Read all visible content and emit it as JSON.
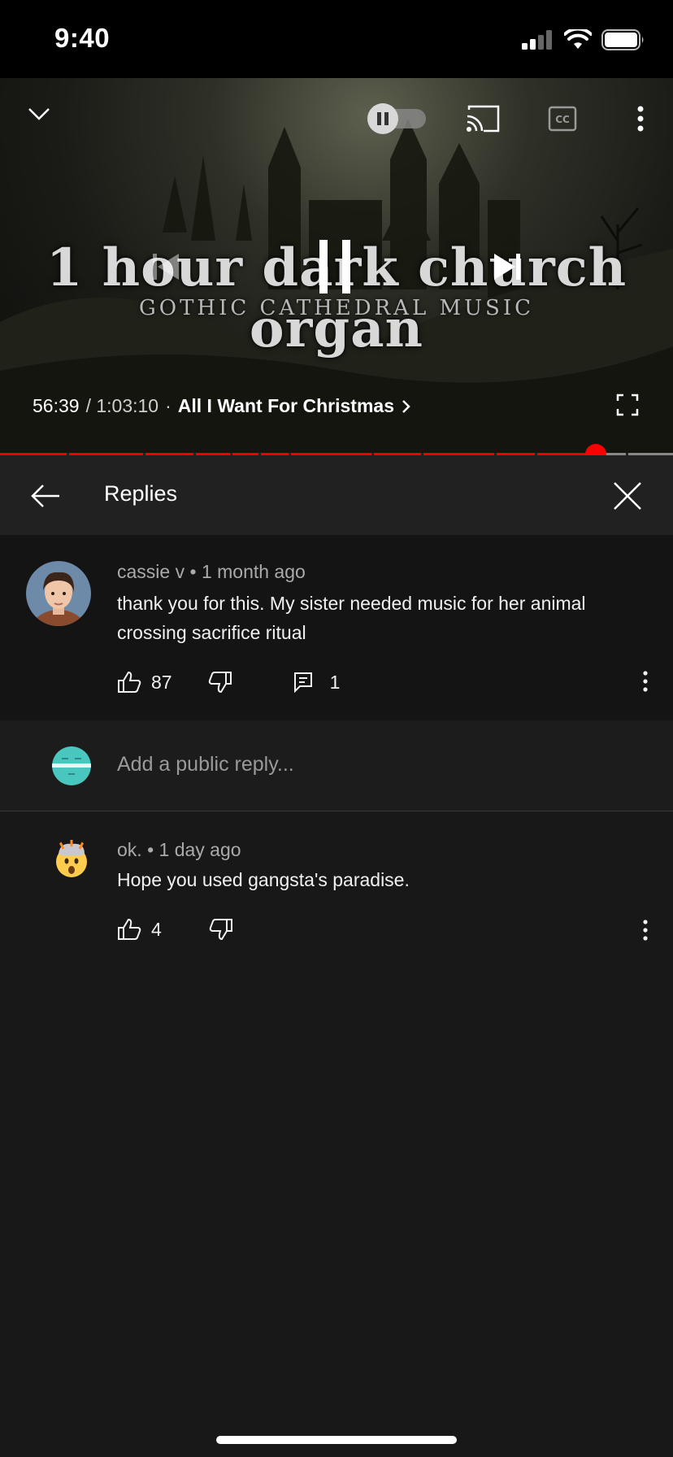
{
  "status_bar": {
    "time": "9:40"
  },
  "player": {
    "art_title": "1 hour dark church organ",
    "art_subtitle": "GOTHIC CATHEDRAL MUSIC",
    "current_time": "56:39",
    "total_time": "/ 1:03:10",
    "separator": "·",
    "next_title": "All I Want For Christmas",
    "progress": 0.885
  },
  "replies_header": {
    "title": "Replies"
  },
  "parent_comment": {
    "author": "cassie v",
    "age": "1 month ago",
    "text": "thank you for this. My sister needed music for her animal crossing sacrifice ritual",
    "likes": "87",
    "replies": "1"
  },
  "add_reply": {
    "placeholder": "Add a public reply..."
  },
  "replies": [
    {
      "author": "ok.",
      "age": "1 day ago",
      "text": "Hope you used gangsta's paradise.",
      "likes": "4"
    }
  ],
  "colors": {
    "accent": "#ff0000",
    "background": "#181818"
  }
}
